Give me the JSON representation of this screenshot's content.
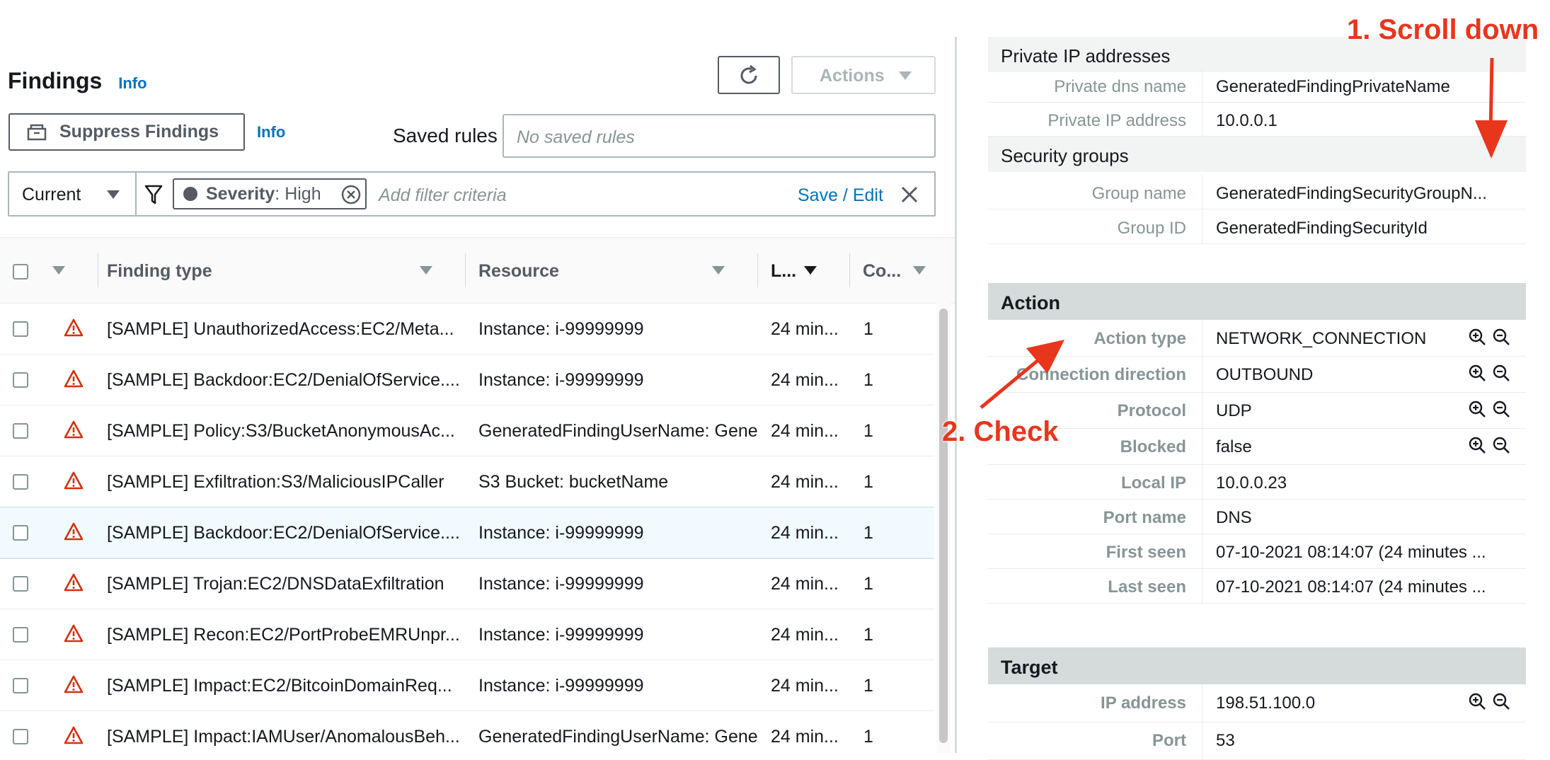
{
  "header": {
    "title": "Findings",
    "title_info": "Info",
    "actions_label": "Actions"
  },
  "toolbar": {
    "suppress_label": "Suppress Findings",
    "suppress_info": "Info",
    "saved_rules_label": "Saved rules",
    "saved_rules_placeholder": "No saved rules"
  },
  "filter": {
    "scope": "Current",
    "token_key": "Severity",
    "token_value": ": High",
    "placeholder": "Add filter criteria",
    "save_edit": "Save / Edit"
  },
  "table": {
    "columns": [
      "Finding type",
      "Resource",
      "L...",
      "Co..."
    ],
    "rows": [
      {
        "type": "[SAMPLE] UnauthorizedAccess:EC2/Meta...",
        "resource": "Instance: i-99999999",
        "last": "24 min...",
        "count": "1",
        "selected": false
      },
      {
        "type": "[SAMPLE] Backdoor:EC2/DenialOfService....",
        "resource": "Instance: i-99999999",
        "last": "24 min...",
        "count": "1",
        "selected": false
      },
      {
        "type": "[SAMPLE] Policy:S3/BucketAnonymousAc...",
        "resource": "GeneratedFindingUserName: Gene",
        "last": "24 min...",
        "count": "1",
        "selected": false
      },
      {
        "type": "[SAMPLE] Exfiltration:S3/MaliciousIPCaller",
        "resource": "S3 Bucket: bucketName",
        "last": "24 min...",
        "count": "1",
        "selected": false
      },
      {
        "type": "[SAMPLE] Backdoor:EC2/DenialOfService....",
        "resource": "Instance: i-99999999",
        "last": "24 min...",
        "count": "1",
        "selected": true
      },
      {
        "type": "[SAMPLE] Trojan:EC2/DNSDataExfiltration",
        "resource": "Instance: i-99999999",
        "last": "24 min...",
        "count": "1",
        "selected": false
      },
      {
        "type": "[SAMPLE] Recon:EC2/PortProbeEMRUnpr...",
        "resource": "Instance: i-99999999",
        "last": "24 min...",
        "count": "1",
        "selected": false
      },
      {
        "type": "[SAMPLE] Impact:EC2/BitcoinDomainReq...",
        "resource": "Instance: i-99999999",
        "last": "24 min...",
        "count": "1",
        "selected": false
      },
      {
        "type": "[SAMPLE] Impact:IAMUser/AnomalousBeh...",
        "resource": "GeneratedFindingUserName: Gene",
        "last": "24 min...",
        "count": "1",
        "selected": false
      }
    ]
  },
  "details": {
    "private_ip_heading": "Private IP addresses",
    "private_dns_key": "Private dns name",
    "private_dns_val": "GeneratedFindingPrivateName",
    "private_ip_key": "Private IP address",
    "private_ip_val": "10.0.0.1",
    "security_groups_heading": "Security groups",
    "group_name_key": "Group name",
    "group_name_val": "GeneratedFindingSecurityGroupN...",
    "group_id_key": "Group ID",
    "group_id_val": "GeneratedFindingSecurityId",
    "action_heading": "Action",
    "action_rows": [
      {
        "key": "Action type",
        "value": "NETWORK_CONNECTION",
        "zoom": true
      },
      {
        "key": "Connection direction",
        "value": "OUTBOUND",
        "zoom": true
      },
      {
        "key": "Protocol",
        "value": "UDP",
        "zoom": true
      },
      {
        "key": "Blocked",
        "value": "false",
        "zoom": true
      },
      {
        "key": "Local IP",
        "value": "10.0.0.23",
        "zoom": false
      },
      {
        "key": "Port name",
        "value": "DNS",
        "zoom": false
      },
      {
        "key": "First seen",
        "value": "07-10-2021 08:14:07 (24 minutes ...",
        "zoom": false
      },
      {
        "key": "Last seen",
        "value": "07-10-2021 08:14:07 (24 minutes ...",
        "zoom": false
      }
    ],
    "target_heading": "Target",
    "target_rows": [
      {
        "key": "IP address",
        "value": "198.51.100.0",
        "zoom": true
      },
      {
        "key": "Port",
        "value": "53",
        "zoom": false
      }
    ]
  },
  "annotations": {
    "scroll_down": "1. Scroll down",
    "check": "2. Check"
  },
  "colors": {
    "link": "#0073bb",
    "severity_high": "#d13212",
    "annotation": "#e8361c",
    "selected_row": "#f1faff"
  },
  "icons": [
    "refresh-icon",
    "caret-down-icon",
    "suppress-icon",
    "funnel-icon",
    "clear-token-icon",
    "close-icon",
    "warning-triangle-icon",
    "zoom-in-icon",
    "zoom-out-icon"
  ]
}
